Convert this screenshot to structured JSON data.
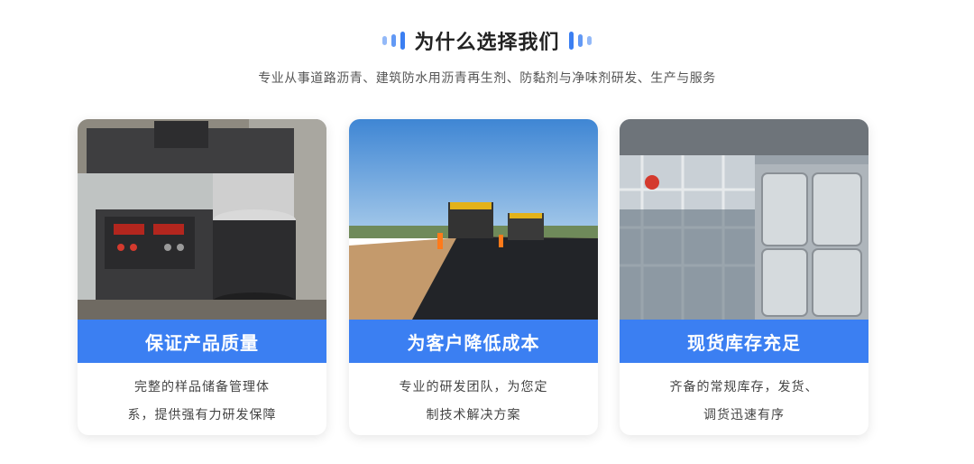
{
  "header": {
    "title": "为什么选择我们",
    "subtitle": "专业从事道路沥青、建筑防水用沥青再生剂、防黏剂与净味剂研发、生产与服务"
  },
  "cards": [
    {
      "title": "保证产品质量",
      "lines": [
        "完整的样品储备管理体",
        "系，提供强有力研发保障"
      ],
      "image_icon": "mixer-machine-photo"
    },
    {
      "title": "为客户降低成本",
      "lines": [
        "专业的研发团队，为您定",
        "制技术解决方案"
      ],
      "image_icon": "road-paving-photo"
    },
    {
      "title": "现货库存充足",
      "lines": [
        "齐备的常规库存，发货、",
        "调货迅速有序"
      ],
      "image_icon": "warehouse-stock-photo"
    }
  ],
  "colors": {
    "accent": "#3b7ff2",
    "text": "#333333"
  }
}
